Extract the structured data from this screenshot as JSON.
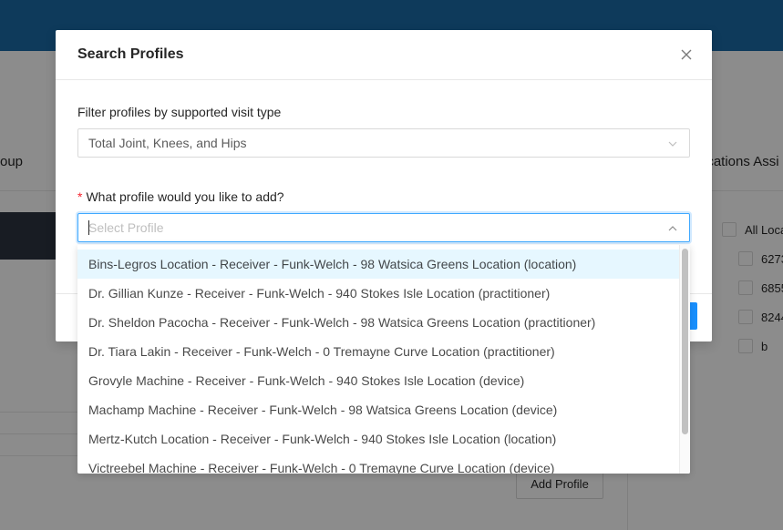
{
  "background": {
    "column_group_label": "oup",
    "column_locations_label": "ocations Assi",
    "location_items": [
      "All Loca",
      "6273",
      "6855",
      "8244",
      "b"
    ],
    "add_profile_label": "Add Profile"
  },
  "modal": {
    "title": "Search Profiles",
    "close_icon": "close-icon",
    "filter_label": "Filter profiles by supported visit type",
    "filter_value": "Total Joint, Knees, and Hips",
    "profile_label": "What profile would you like to add?",
    "profile_required_mark": "*",
    "profile_placeholder": "Select Profile"
  },
  "dropdown": {
    "options": [
      "Bins-Legros Location - Receiver - Funk-Welch - 98 Watsica Greens Location (location)",
      "Dr. Gillian Kunze - Receiver - Funk-Welch - 940 Stokes Isle Location (practitioner)",
      "Dr. Sheldon Pacocha - Receiver - Funk-Welch - 98 Watsica Greens Location (practitioner)",
      "Dr. Tiara Lakin - Receiver - Funk-Welch - 0 Tremayne Curve Location (practitioner)",
      "Grovyle Machine - Receiver - Funk-Welch - 940 Stokes Isle Location (device)",
      "Machamp Machine - Receiver - Funk-Welch - 98 Watsica Greens Location (device)",
      "Mertz-Kutch Location - Receiver - Funk-Welch - 940 Stokes Isle Location (location)",
      "Victreebel Machine - Receiver - Funk-Welch - 0 Tremayne Curve Location (device)"
    ],
    "active_index": 0
  },
  "colors": {
    "topbar": "#1a6aa7",
    "primary": "#1890ff",
    "active_option_bg": "#e6f7ff",
    "required": "#f5222d"
  }
}
